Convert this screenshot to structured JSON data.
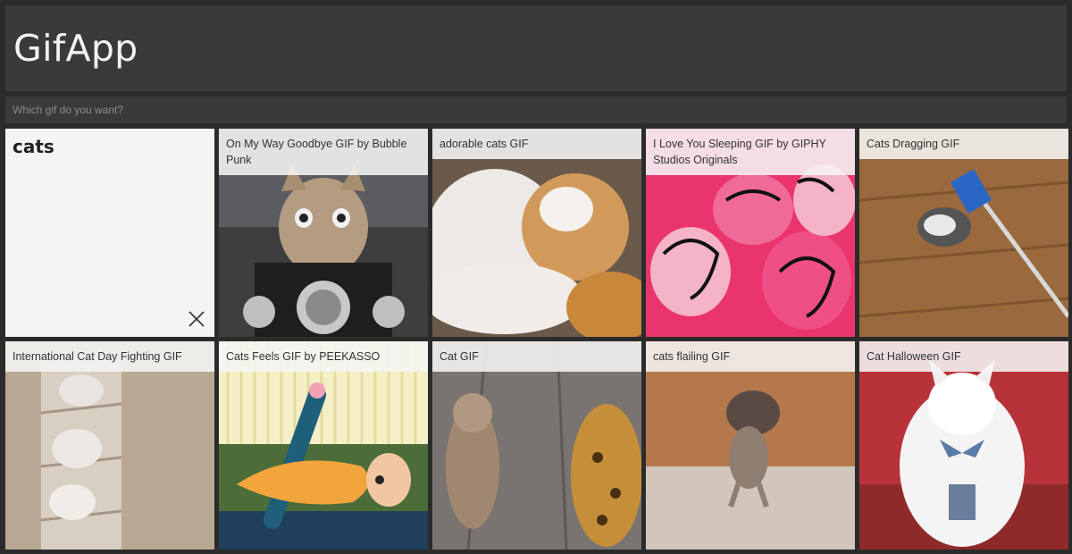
{
  "app": {
    "title": "GifApp"
  },
  "search": {
    "placeholder": "Which gif do you want?",
    "value": ""
  },
  "query": {
    "term": "cats",
    "clear_icon": "close-icon"
  },
  "gifs": [
    {
      "title": "On My Way Goodbye GIF by Bubble Punk"
    },
    {
      "title": "adorable cats GIF"
    },
    {
      "title": "I Love You Sleeping GIF by GIPHY Studios Originals"
    },
    {
      "title": "Cats Dragging GIF"
    },
    {
      "title": "International Cat Day Fighting GIF"
    },
    {
      "title": "Cats Feels GIF by PEEKASSO"
    },
    {
      "title": "Cat GIF"
    },
    {
      "title": "cats flailing GIF"
    },
    {
      "title": "Cat Halloween GIF"
    }
  ]
}
